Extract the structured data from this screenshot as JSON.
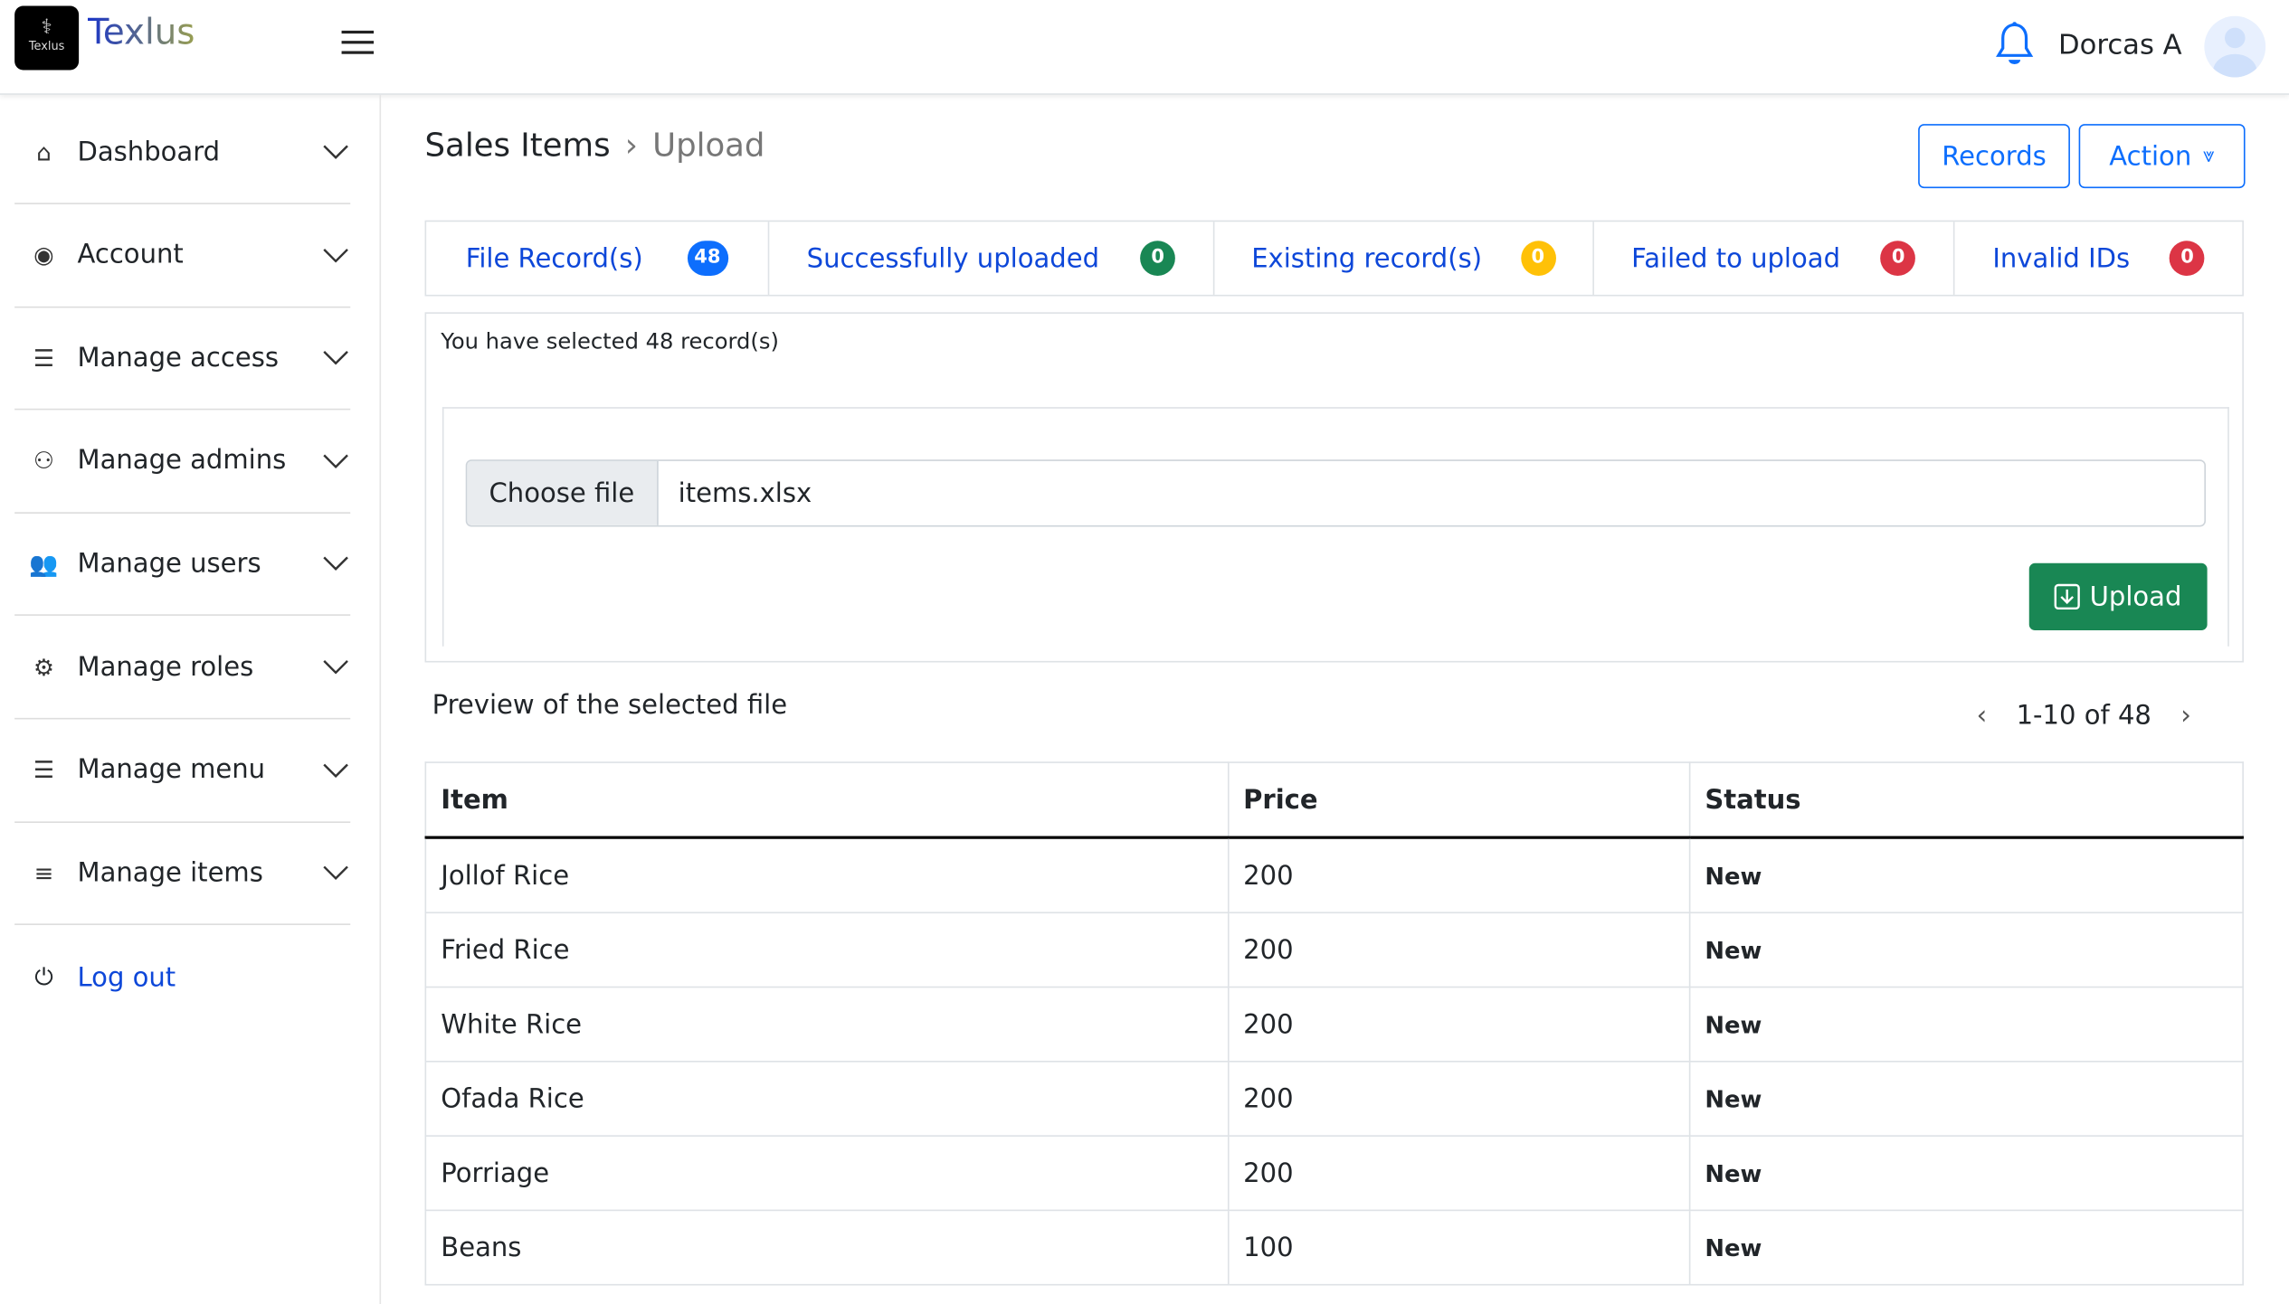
{
  "header": {
    "logo_text": "Texlus",
    "brand": "Texlus",
    "user_name": "Dorcas A"
  },
  "sidebar": {
    "items": [
      {
        "label": "Dashboard",
        "icon": "home-icon"
      },
      {
        "label": "Account",
        "icon": "user-circle-icon"
      },
      {
        "label": "Manage access",
        "icon": "list-icon"
      },
      {
        "label": "Manage admins",
        "icon": "people-outline-icon"
      },
      {
        "label": "Manage users",
        "icon": "people-fill-icon"
      },
      {
        "label": "Manage roles",
        "icon": "gear-icon"
      },
      {
        "label": "Manage menu",
        "icon": "list-icon"
      },
      {
        "label": "Manage items",
        "icon": "menu-icon"
      }
    ],
    "logout": "Log out"
  },
  "breadcrumb": {
    "parent": "Sales Items",
    "current": "Upload"
  },
  "buttons": {
    "records": "Records",
    "action": "Action"
  },
  "tabs": [
    {
      "label": "File Record(s)",
      "count": "48",
      "color": "#0d6efd"
    },
    {
      "label": "Successfully uploaded",
      "count": "0",
      "color": "#198754"
    },
    {
      "label": "Existing record(s)",
      "count": "0",
      "color": "#ffc107"
    },
    {
      "label": "Failed to upload",
      "count": "0",
      "color": "#dc3545"
    },
    {
      "label": "Invalid IDs",
      "count": "0",
      "color": "#dc3545"
    }
  ],
  "upload": {
    "selected_text": "You have selected 48 record(s)",
    "choose_file": "Choose file",
    "file_name": "items.xlsx",
    "upload_label": "Upload"
  },
  "preview": {
    "title": "Preview of the selected file",
    "pager": "1-10 of 48"
  },
  "table": {
    "columns": [
      "Item",
      "Price",
      "Status"
    ],
    "rows": [
      [
        "Jollof Rice",
        "200",
        "New"
      ],
      [
        "Fried Rice",
        "200",
        "New"
      ],
      [
        "White Rice",
        "200",
        "New"
      ],
      [
        "Ofada Rice",
        "200",
        "New"
      ],
      [
        "Porriage",
        "200",
        "New"
      ],
      [
        "Beans",
        "100",
        "New"
      ]
    ]
  }
}
